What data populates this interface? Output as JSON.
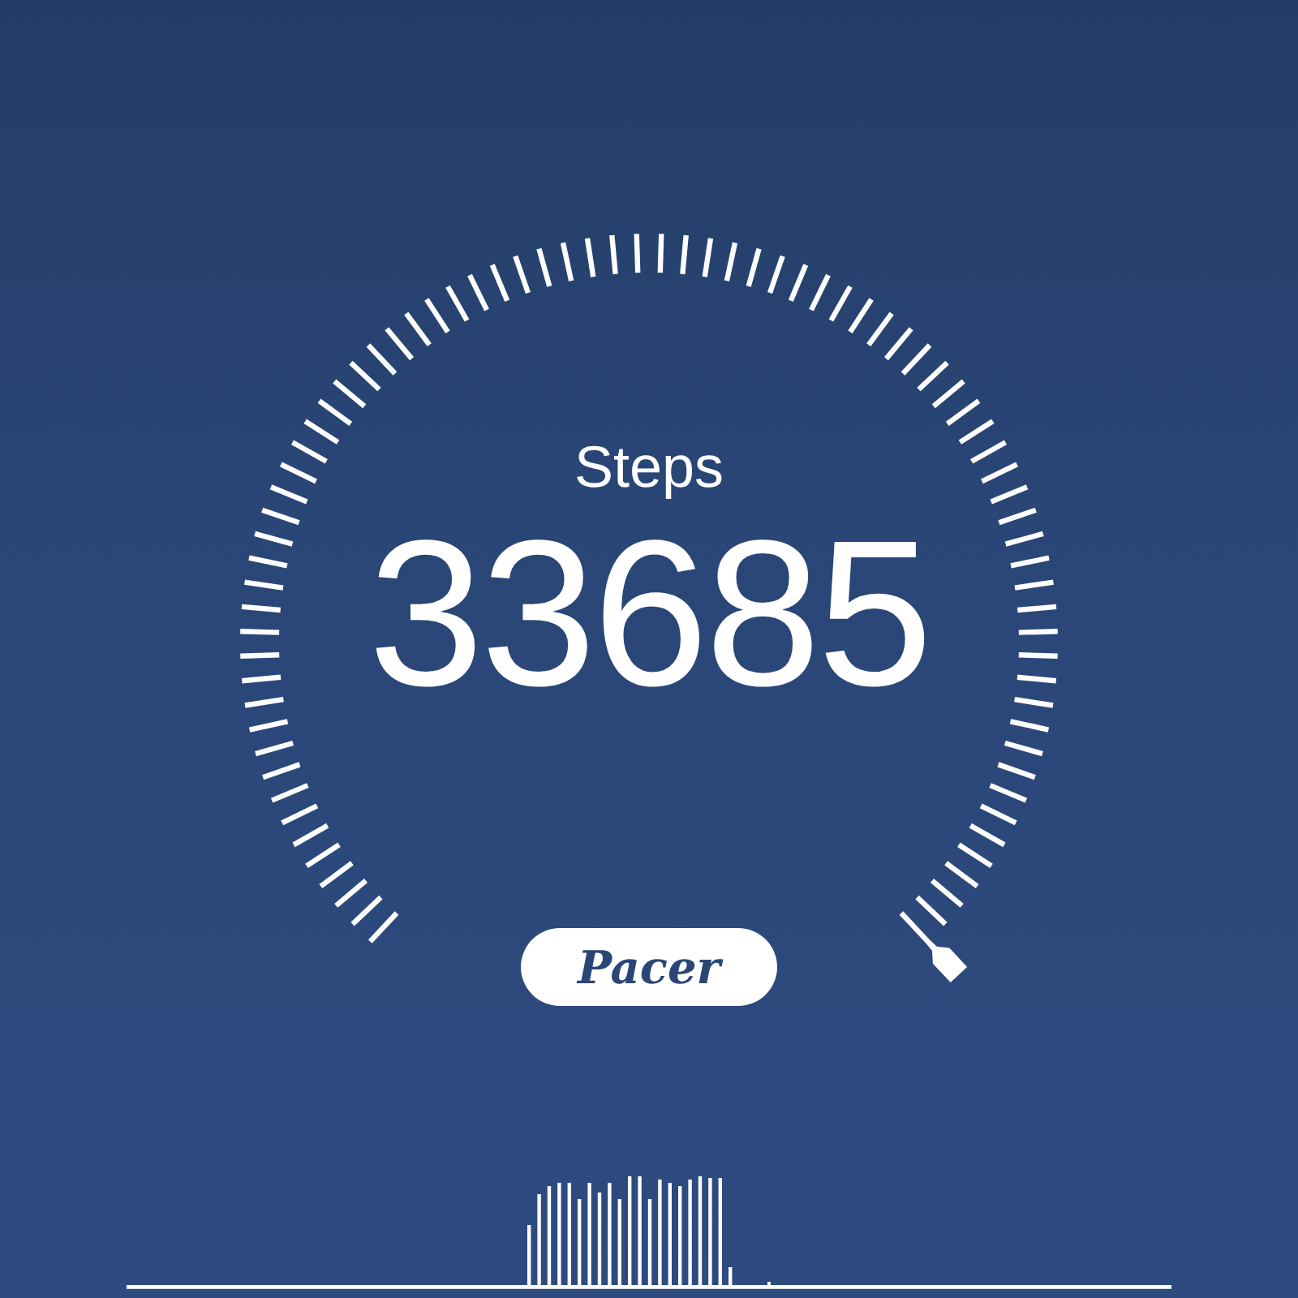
{
  "gauge": {
    "label": "Steps",
    "value": "33685"
  },
  "logo": {
    "text": "Pacer"
  }
}
